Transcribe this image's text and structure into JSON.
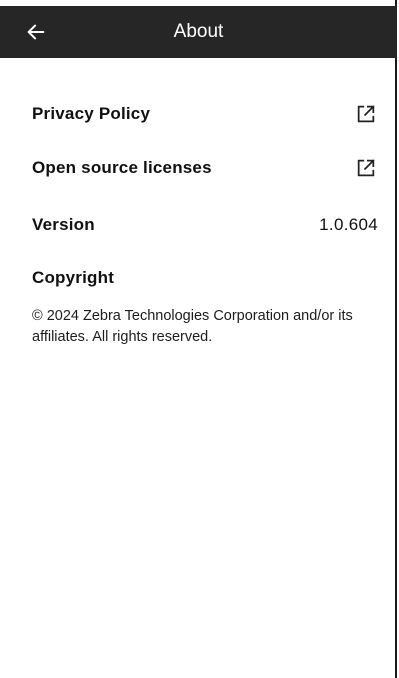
{
  "app_bar": {
    "title": "About",
    "back_icon": "arrow-left-icon"
  },
  "items": {
    "privacy_policy": {
      "label": "Privacy Policy",
      "icon": "open-in-new-icon"
    },
    "open_source": {
      "label": "Open source licenses",
      "icon": "open-in-new-icon"
    },
    "version": {
      "label": "Version",
      "value": "1.0.604"
    }
  },
  "copyright": {
    "heading": "Copyright",
    "text": "© 2024 Zebra Technologies Corporation and/or its affiliates. All rights reserved."
  },
  "colors": {
    "app_bar_background": "#262626",
    "app_bar_text": "#ffffff",
    "page_background": "#ffffff",
    "text": "#111111"
  }
}
